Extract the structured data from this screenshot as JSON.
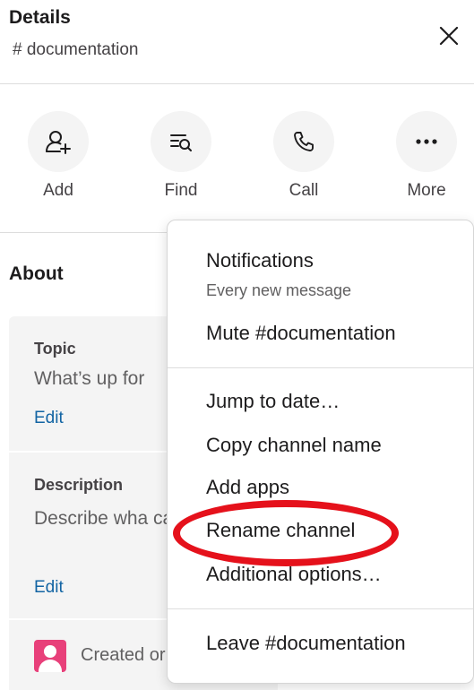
{
  "header": {
    "title": "Details",
    "channel": "# documentation"
  },
  "actions": [
    {
      "label": "Add",
      "icon": "add-person-icon"
    },
    {
      "label": "Find",
      "icon": "find-icon"
    },
    {
      "label": "Call",
      "icon": "phone-icon"
    },
    {
      "label": "More",
      "icon": "more-icon"
    }
  ],
  "about": {
    "title": "About",
    "topic_label": "Topic",
    "topic_text": "What’s up for",
    "topic_edit": "Edit",
    "description_label": "Description",
    "description_text": "Describe wha can find it.",
    "description_edit": "Edit",
    "created_text": "Created or"
  },
  "menu": {
    "notifications": "Notifications",
    "notifications_sub": "Every new message",
    "mute": "Mute #documentation",
    "jump": "Jump to date…",
    "copy": "Copy channel name",
    "add_apps": "Add apps",
    "rename": "Rename channel",
    "additional": "Additional options…",
    "leave": "Leave #documentation"
  },
  "colors": {
    "accent_link": "#1264a3",
    "highlight_ring": "#e5111b",
    "avatar": "#e8407a"
  }
}
